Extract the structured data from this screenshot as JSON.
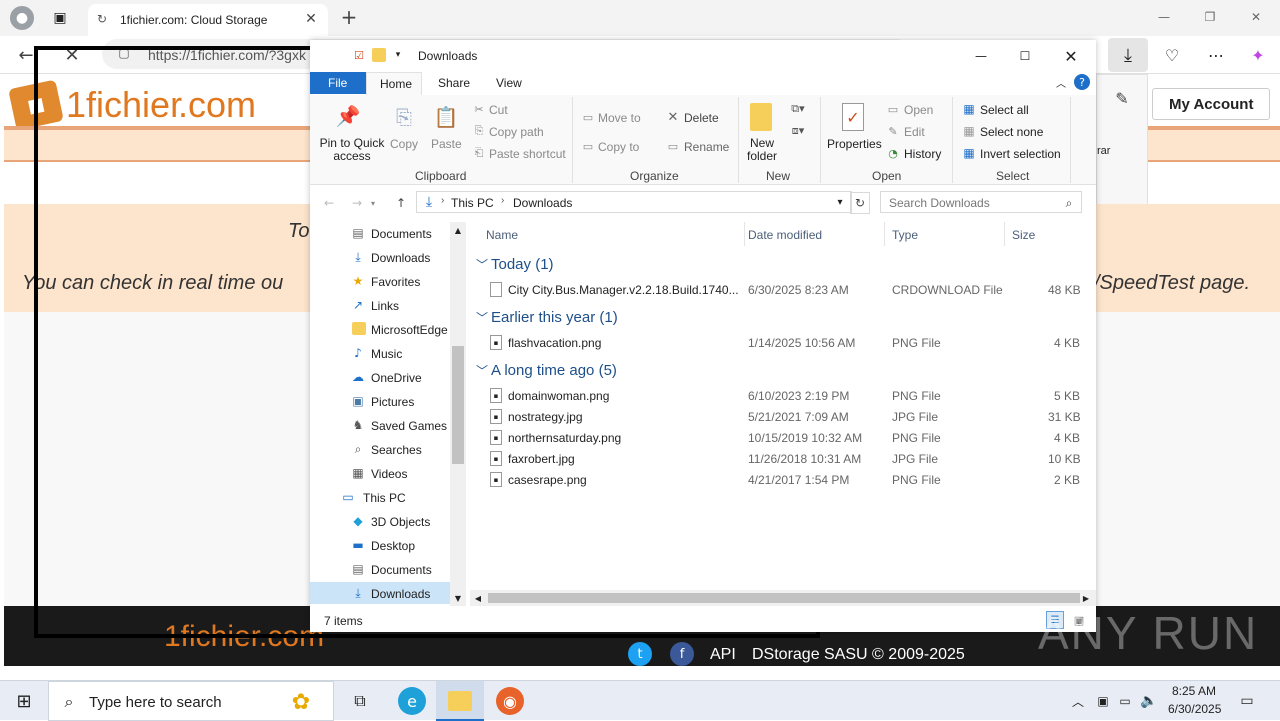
{
  "browser": {
    "tab_title": "1fichier.com: Cloud Storage",
    "url": "https://1fichier.com/?3gxk",
    "account_button": "My Account",
    "partial_text": "rar"
  },
  "site": {
    "logo_text_1": "1fichier",
    "logo_text_2": ".com",
    "info_line1": "To",
    "info_line2_left": "You can check in real time ou",
    "info_line2_right": "/SpeedTest page.",
    "footer_api": "API",
    "footer_copyright": "DStorage SASU © 2009-2025",
    "footer_logo": "1fichier.com"
  },
  "explorer": {
    "qat_title": "Downloads",
    "menu": {
      "file": "File",
      "home": "Home",
      "share": "Share",
      "view": "View"
    },
    "ribbon": {
      "pin": "Pin to Quick access",
      "copy": "Copy",
      "paste": "Paste",
      "cut": "Cut",
      "copy_path": "Copy path",
      "paste_shortcut": "Paste shortcut",
      "group_clipboard": "Clipboard",
      "move_to": "Move to",
      "copy_to": "Copy to",
      "delete": "Delete",
      "rename": "Rename",
      "group_organize": "Organize",
      "new_folder": "New folder",
      "group_new": "New",
      "properties": "Properties",
      "open": "Open",
      "edit": "Edit",
      "history": "History",
      "group_open": "Open",
      "select_all": "Select all",
      "select_none": "Select none",
      "invert_selection": "Invert selection",
      "group_select": "Select"
    },
    "breadcrumb": {
      "this_pc": "This PC",
      "downloads": "Downloads"
    },
    "search_placeholder": "Search Downloads",
    "nav": [
      "Documents",
      "Downloads",
      "Favorites",
      "Links",
      "MicrosoftEdge",
      "Music",
      "OneDrive",
      "Pictures",
      "Saved Games",
      "Searches",
      "Videos",
      "This PC",
      "3D Objects",
      "Desktop",
      "Documents",
      "Downloads"
    ],
    "columns": {
      "name": "Name",
      "date": "Date modified",
      "type": "Type",
      "size": "Size"
    },
    "groups": [
      {
        "label": "Today (1)",
        "files": [
          {
            "name": "City City.Bus.Manager.v2.2.18.Build.1740...",
            "date": "6/30/2025 8:23 AM",
            "type": "CRDOWNLOAD File",
            "size": "48 KB"
          }
        ]
      },
      {
        "label": "Earlier this year (1)",
        "files": [
          {
            "name": "flashvacation.png",
            "date": "1/14/2025 10:56 AM",
            "type": "PNG File",
            "size": "4 KB"
          }
        ]
      },
      {
        "label": "A long time ago (5)",
        "files": [
          {
            "name": "domainwoman.png",
            "date": "6/10/2023 2:19 PM",
            "type": "PNG File",
            "size": "5 KB"
          },
          {
            "name": "nostrategy.jpg",
            "date": "5/21/2021 7:09 AM",
            "type": "JPG File",
            "size": "31 KB"
          },
          {
            "name": "northernsaturday.png",
            "date": "10/15/2019 10:32 AM",
            "type": "PNG File",
            "size": "4 KB"
          },
          {
            "name": "faxrobert.jpg",
            "date": "11/26/2018 10:31 AM",
            "type": "JPG File",
            "size": "10 KB"
          },
          {
            "name": "casesrape.png",
            "date": "4/21/2017 1:54 PM",
            "type": "PNG File",
            "size": "2 KB"
          }
        ]
      }
    ],
    "status": "7 items"
  },
  "taskbar": {
    "search_placeholder": "Type here to search",
    "time": "8:25 AM",
    "date": "6/30/2025"
  },
  "watermark": "ANY RUN"
}
